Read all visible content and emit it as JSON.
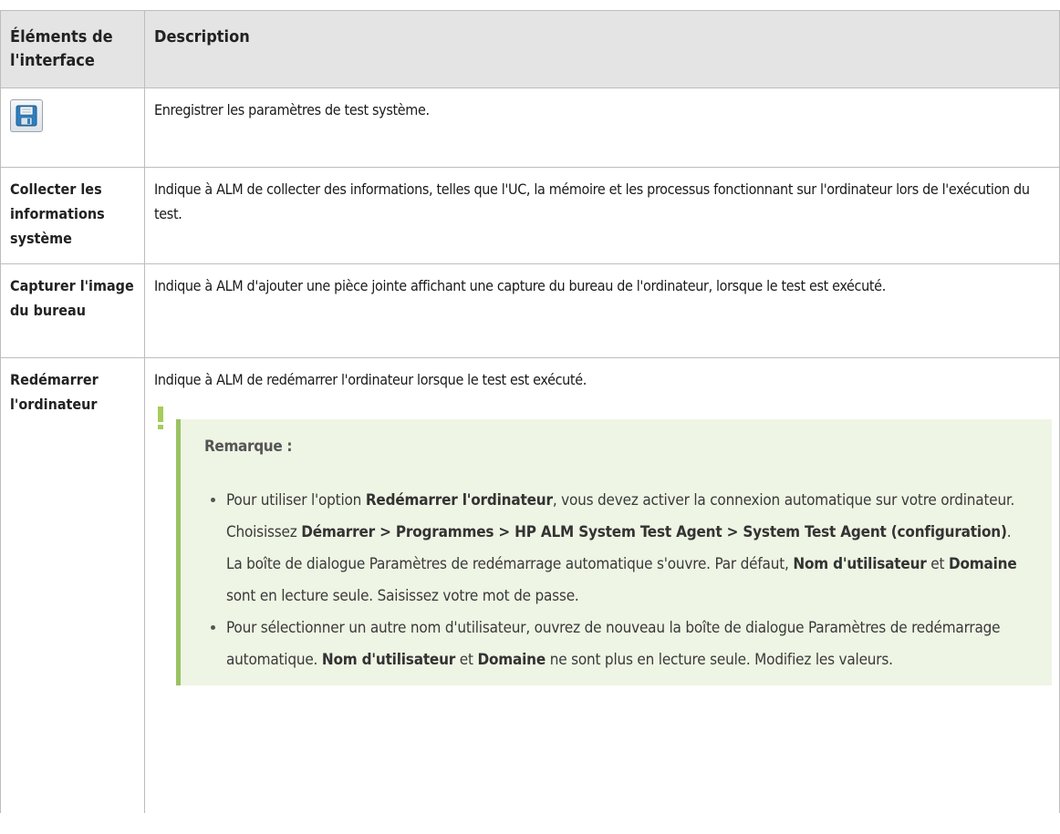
{
  "table": {
    "header": {
      "col1": "Éléments de l'interface",
      "col2": "Description"
    },
    "rows": [
      {
        "element_icon": "save-icon",
        "description": "Enregistrer les paramètres de test système."
      },
      {
        "element": "Collecter les informations système",
        "description": "Indique à ALM de collecter des informations, telles que l'UC, la mémoire et les processus fonctionnant sur l'ordinateur lors de l'exécution du test."
      },
      {
        "element": "Capturer l'image du bureau",
        "description": "Indique à ALM d'ajouter une pièce jointe affichant une capture du bureau de l'ordinateur, lorsque le test est exécuté."
      },
      {
        "element": "Redémarrer l'ordinateur",
        "description": "Indique à ALM de redémarrer l'ordinateur lorsque le test est exécuté."
      }
    ]
  },
  "note": {
    "title": "Remarque :",
    "item1": {
      "p1": "Pour utiliser l'option ",
      "b1": "Redémarrer l'ordinateur",
      "p2": ", vous devez activer la connexion automatique sur votre ordinateur. Choisissez ",
      "b2": "Démarrer > Programmes > HP ALM System Test Agent > System Test Agent (configuration)",
      "p3": ". La boîte de dialogue Paramètres de redémarrage automatique s'ouvre. Par défaut, ",
      "b3": "Nom d'utilisateur",
      "p4": " et ",
      "b4": "Domaine",
      "p5": " sont en lecture seule. Saisissez votre mot de passe."
    },
    "item2": {
      "p1": "Pour sélectionner un autre nom d'utilisateur, ouvrez de nouveau la boîte de dialogue Paramètres de redémarrage automatique. ",
      "b1": "Nom d'utilisateur",
      "p2": " et ",
      "b2": "Domaine",
      "p3": " ne sont plus en lecture seule. Modifiez les valeurs."
    }
  },
  "colors": {
    "header_bg": "#e4e4e4",
    "border": "#bdbdbd",
    "note_bg": "#eef5e4",
    "note_accent": "#9ac262",
    "flag": "#a6cc5c"
  }
}
